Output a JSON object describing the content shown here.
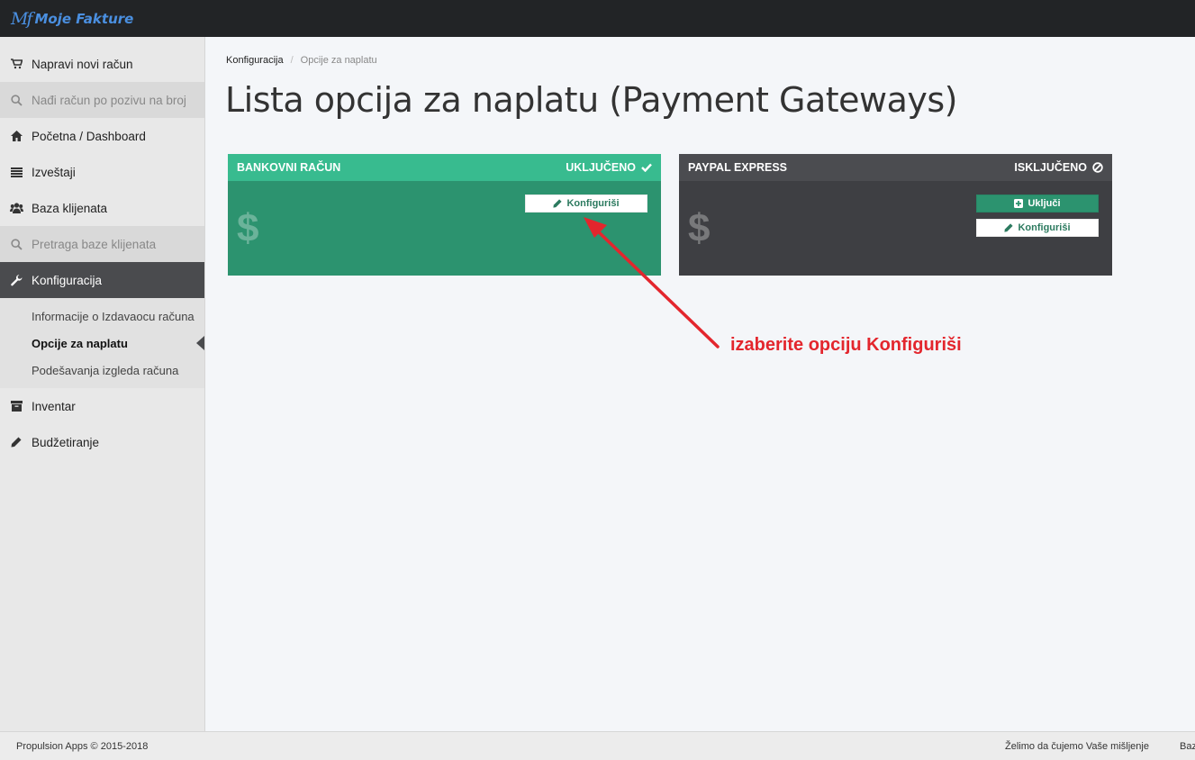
{
  "app": {
    "logo_mark": "Mf",
    "logo_text": "Moje Fakture"
  },
  "sidebar": {
    "items": [
      {
        "label": "Napravi novi račun",
        "icon": "cart-icon"
      },
      {
        "label": "Nađi račun po pozivu na broj",
        "icon": "search-icon"
      },
      {
        "label": "Početna / Dashboard",
        "icon": "home-icon"
      },
      {
        "label": "Izveštaji",
        "icon": "list-icon"
      },
      {
        "label": "Baza klijenata",
        "icon": "users-icon"
      },
      {
        "label": "Pretraga baze klijenata",
        "icon": "search-icon"
      },
      {
        "label": "Konfiguracija",
        "icon": "wrench-icon"
      },
      {
        "label": "Inventar",
        "icon": "archive-icon"
      },
      {
        "label": "Budžetiranje",
        "icon": "pencil-icon"
      }
    ],
    "submenu": [
      {
        "label": "Informacije o Izdavaocu računa"
      },
      {
        "label": "Opcije za naplatu"
      },
      {
        "label": "Podešavanja izgleda računa"
      }
    ]
  },
  "breadcrumb": {
    "parent": "Konfiguracija",
    "separator": "/",
    "current": "Opcije za naplatu"
  },
  "page_title": "Lista opcija za naplatu (Payment Gateways)",
  "gateways": [
    {
      "name": "BANKOVNI RAČUN",
      "status": "UKLJUČENO",
      "status_icon": "check-icon",
      "symbol": "$",
      "configure_label": "Konfiguriši",
      "color_head": "#38bb8f",
      "color_body": "#2c936f"
    },
    {
      "name": "PAYPAL EXPRESS",
      "status": "ISKLJUČENO",
      "status_icon": "ban-icon",
      "symbol": "$",
      "enable_label": "Uključi",
      "configure_label": "Konfiguriši",
      "color_head": "#4b4c50",
      "color_body": "#3e3f43"
    }
  ],
  "annotation": {
    "text": "izaberite opciju Konfiguriši",
    "color": "#e3262d"
  },
  "footer": {
    "copyright": "Propulsion Apps © 2015-2018",
    "feedback": "Želimo da čujemo Vaše mišljenje",
    "more": "Baz"
  }
}
